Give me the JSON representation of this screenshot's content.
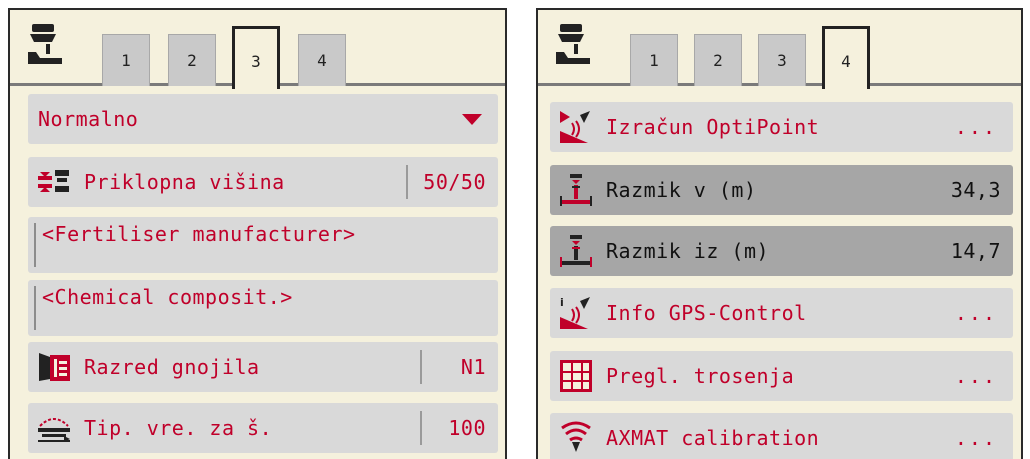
{
  "left_panel": {
    "tabs": [
      "1",
      "2",
      "3",
      "4"
    ],
    "active_tab": "3",
    "dropdown": {
      "value": "Normalno"
    },
    "rows": [
      {
        "icon": "hitch-height-icon",
        "label": "Priklopna višina",
        "value": "50/50"
      },
      {
        "label": "<Fertiliser manufacturer>"
      },
      {
        "label": "<Chemical composit.>"
      },
      {
        "icon": "fertilizer-class-icon",
        "label": "Razred gnojila",
        "value": "N1"
      },
      {
        "icon": "spreading-disc-icon",
        "label": "Tip. vre. za š.",
        "value": "100"
      }
    ]
  },
  "right_panel": {
    "tabs": [
      "1",
      "2",
      "3",
      "4"
    ],
    "active_tab": "4",
    "rows": [
      {
        "icon": "optipoint-icon",
        "label": "Izračun OptiPoint",
        "value": "..."
      },
      {
        "icon": "distance-on-icon",
        "label": "Razmik v (m)",
        "value": "34,3"
      },
      {
        "icon": "distance-off-icon",
        "label": "Razmik iz (m)",
        "value": "14,7"
      },
      {
        "icon": "gps-info-icon",
        "label": "Info GPS-Control",
        "value": "..."
      },
      {
        "icon": "spread-overview-icon",
        "label": "Pregl. trosenja",
        "value": "..."
      },
      {
        "icon": "axmat-calibration-icon",
        "label": "AXMAT calibration",
        "value": "..."
      }
    ]
  },
  "colors": {
    "accent": "#c0002a",
    "panel_bg": "#f5f1dd",
    "row_bg": "#d9d9d9",
    "row_selected": "#a6a6a6"
  }
}
